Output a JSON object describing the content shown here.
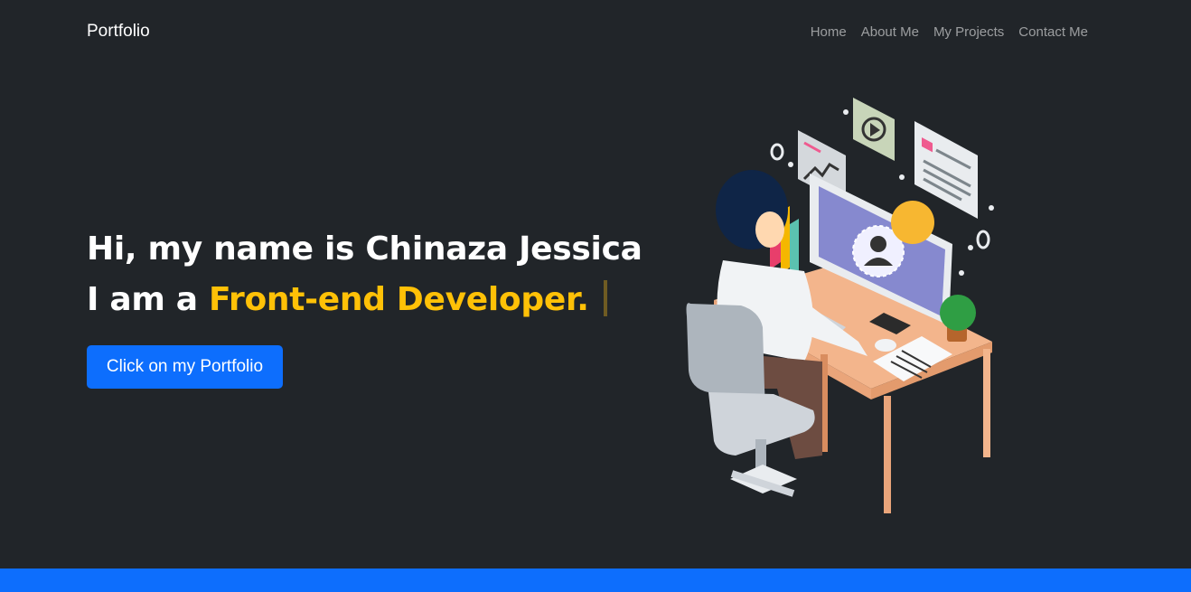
{
  "nav": {
    "brand": "Portfolio",
    "links": [
      "Home",
      "About Me",
      "My Projects",
      "Contact Me"
    ]
  },
  "hero": {
    "line1": "Hi, my name is Chinaza Jessica",
    "line2_prefix": "I am a ",
    "line2_highlight": "Front-end Developer.",
    "button_label": "Click on my Portfolio"
  },
  "colors": {
    "background": "#212529",
    "accent": "#ffc107",
    "primary": "#0d6efd"
  },
  "illustration": {
    "icon": "developer-at-desk-illustration"
  }
}
